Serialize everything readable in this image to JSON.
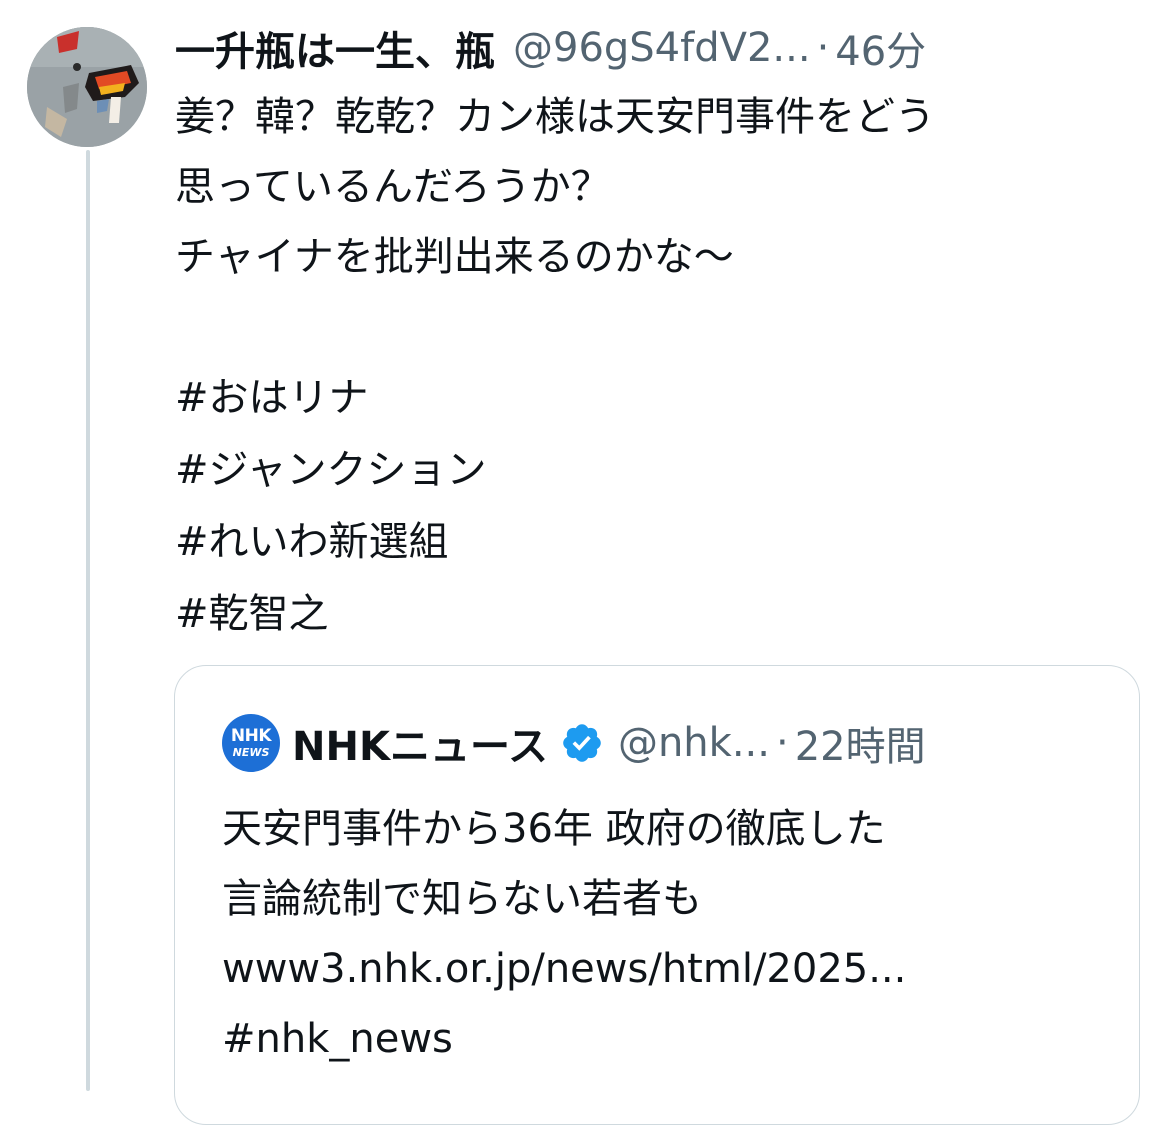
{
  "tweet": {
    "name": "一升瓶は一生、瓶",
    "handle": "@96gS4fdV2...",
    "separator": "·",
    "time": "46分",
    "text": "姜？韓？乾乾？カン様は天安門事件をどう\n思っているんだろうか？\nチャイナを批判出来るのかな〜",
    "hashtags": [
      "#おはリナ",
      "#ジャンクション",
      "#れいわ新選組",
      "#乾智之"
    ]
  },
  "quote": {
    "avatar_line1": "NHK",
    "avatar_line2": "NEWS",
    "name": "NHKニュース",
    "handle": "@nhk...",
    "separator": "·",
    "time": "22時間",
    "text": "天安門事件から36年 政府の徹底した\n言論統制で知らない若者も\nwww3.nhk.or.jp/news/html/2025...\n#nhk_news"
  },
  "colors": {
    "text": "#0f1419",
    "muted": "#536471",
    "border": "#cfd9de",
    "verified": "#1d9bf0",
    "nhk_blue": "#1d6fd6"
  },
  "icons": {
    "avatar": "user-avatar-painting",
    "verified": "verified-badge-icon"
  }
}
